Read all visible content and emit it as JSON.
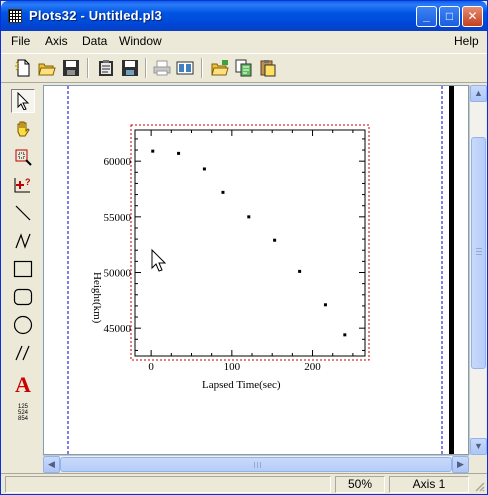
{
  "window": {
    "title": "Plots32 - Untitled.pl3",
    "minimize_glyph": "_",
    "maximize_glyph": "□",
    "close_glyph": "✕"
  },
  "menu": {
    "items": [
      "File",
      "Axis",
      "Data",
      "Window"
    ],
    "help": "Help"
  },
  "toolbar": {
    "icons": [
      "new-file-icon",
      "open-folder-icon",
      "save-disk-icon",
      "clipboard-icon",
      "save-as-icon",
      "print-icon",
      "preview-icon",
      "open-data-icon",
      "copy-data-icon",
      "paste-data-icon"
    ]
  },
  "sidebar": {
    "tools": [
      "pointer-arrow-icon",
      "hand-pan-icon",
      "zoom-box-icon",
      "add-point-icon",
      "line-icon",
      "polyline-icon",
      "rectangle-icon",
      "rounded-rect-icon",
      "ellipse-icon",
      "parallel-lines-icon",
      "text-icon",
      "data-values-icon"
    ],
    "text_tool_label": "A",
    "data_values_label": [
      "125",
      "524",
      "854"
    ]
  },
  "chart_data": {
    "type": "scatter",
    "title": "",
    "xlabel": "Lapsed Time(sec)",
    "ylabel": "Height(km)",
    "xlim": [
      -20,
      265
    ],
    "ylim": [
      42500,
      62800
    ],
    "xticks": [
      0,
      100,
      200
    ],
    "yticks": [
      45000,
      50000,
      55000,
      60000
    ],
    "xtick_labels": [
      "0",
      "100",
      "200"
    ],
    "ytick_labels": [
      "45000",
      "50000",
      "55000",
      "60000"
    ],
    "grid": false,
    "series": [
      {
        "x": [
          2,
          34,
          66,
          89,
          121,
          153,
          184,
          216,
          240
        ],
        "y": [
          60900,
          60700,
          59300,
          57200,
          55000,
          52900,
          50100,
          47100,
          44400
        ]
      }
    ],
    "marker_color": "#000000",
    "frame_color": "#cc0000"
  },
  "status": {
    "zoom": "50%",
    "axis": "Axis 1"
  },
  "colors": {
    "accent": "#0054e3",
    "page_guide": "#0000cc",
    "chart_frame": "#cc0000"
  }
}
